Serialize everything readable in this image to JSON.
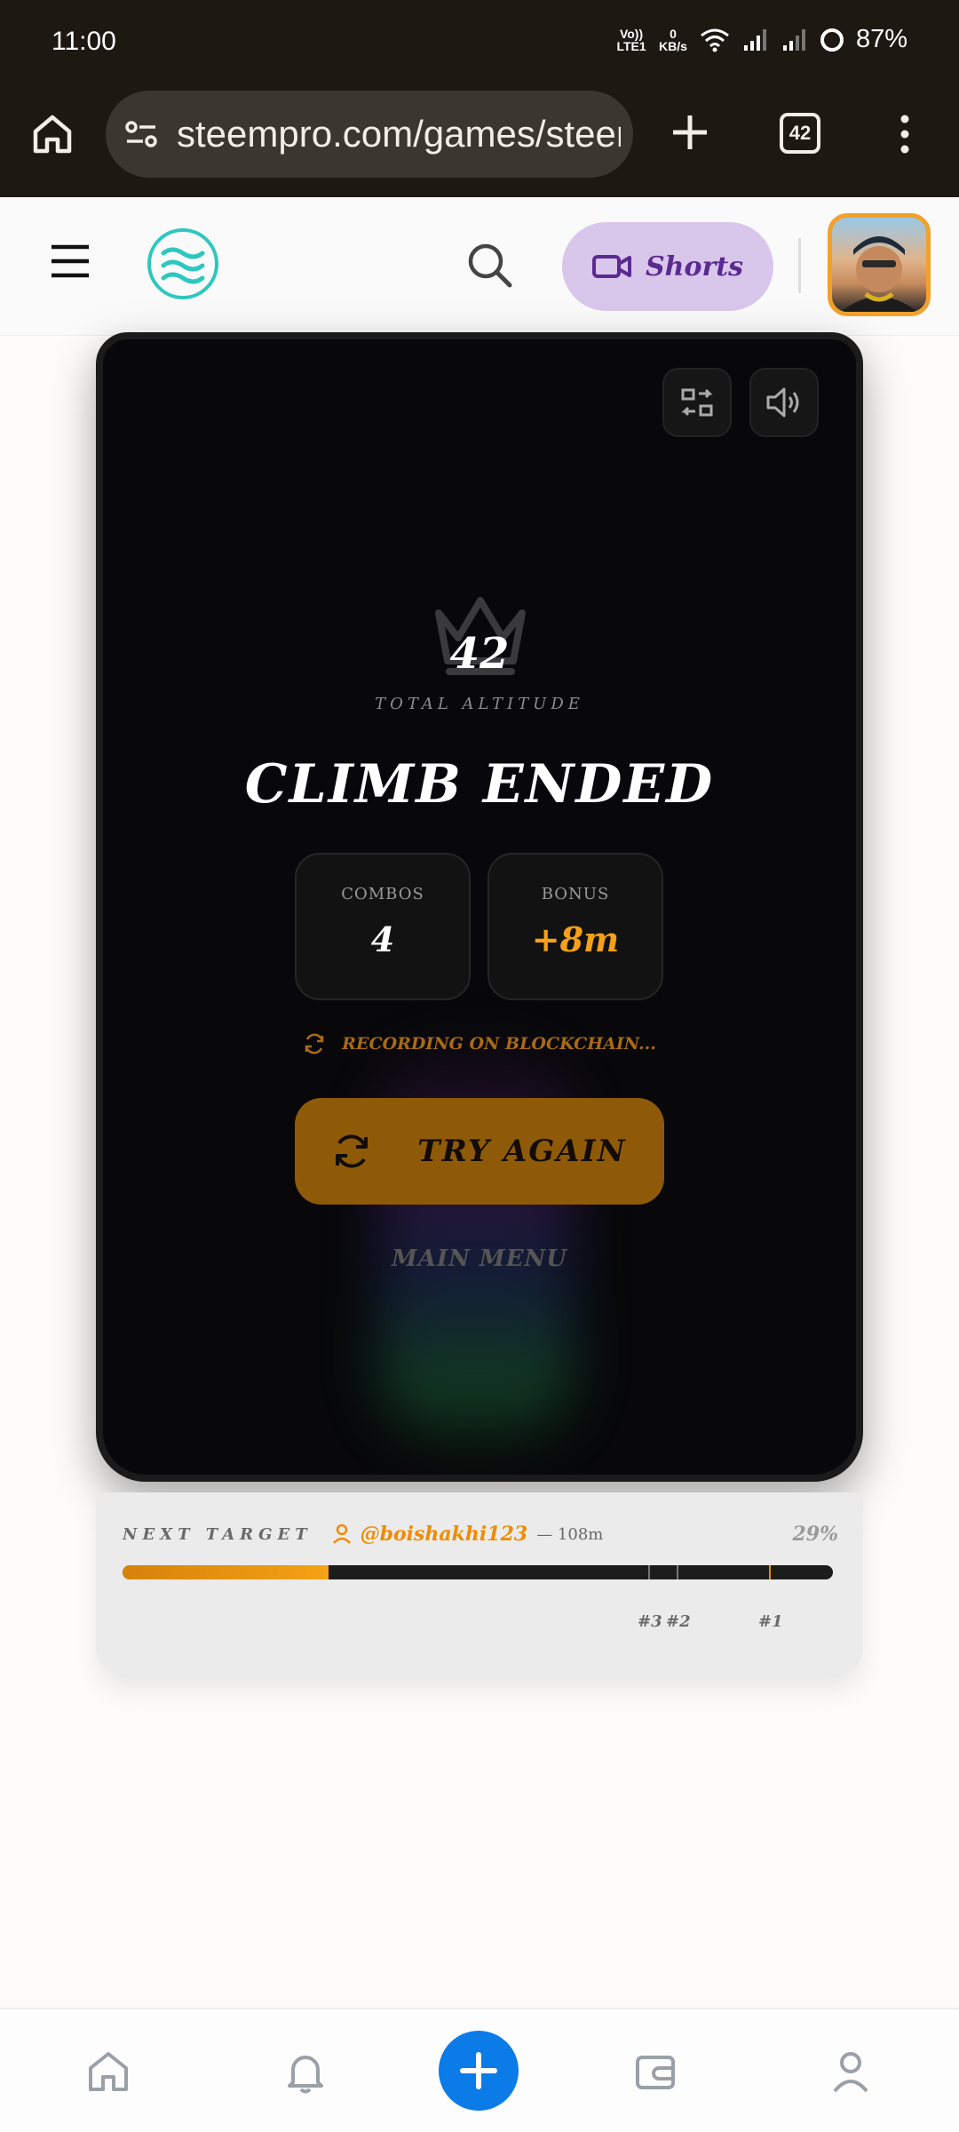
{
  "status_bar": {
    "time": "11:00",
    "network_rate_top": "0",
    "network_rate_unit": "KB/s",
    "volte_label": "Vo)) LTE1",
    "battery": "87%"
  },
  "browser": {
    "url": "steempro.com/games/steer",
    "tab_count": "42"
  },
  "header": {
    "shorts_label": "Shorts"
  },
  "game": {
    "score": "42",
    "score_caption": "TOTAL ALTITUDE",
    "title": "CLIMB ENDED",
    "stats": [
      {
        "label": "COMBOS",
        "value": "4"
      },
      {
        "label": "BONUS",
        "value": "+8m"
      }
    ],
    "recording_text": "RECORDING ON BLOCKCHAIN...",
    "try_again_label": "TRY AGAIN",
    "main_menu_label": "MAIN MENU"
  },
  "next_target": {
    "label": "NEXT TARGET",
    "user": "@boishakhi123",
    "distance": "— 108m",
    "progress_text": "29%",
    "progress": 0.29,
    "ranks": [
      {
        "label": "#3",
        "position": 0.74
      },
      {
        "label": "#2",
        "position": 0.78
      },
      {
        "label": "#1",
        "position": 0.91
      }
    ]
  },
  "colors": {
    "accent_orange": "#f5a017",
    "fab_blue": "#0b7be8",
    "shorts_bg": "#d9c6eb",
    "logo_teal": "#2ec7bf"
  },
  "icons": [
    "home-icon",
    "tune-icon",
    "plus-icon",
    "more-icon",
    "menu-icon",
    "search-icon",
    "video-icon",
    "exit-fullscreen-icon",
    "volume-icon",
    "crown-icon",
    "refresh-icon",
    "user-icon",
    "bell-icon",
    "wallet-icon",
    "profile-icon"
  ]
}
